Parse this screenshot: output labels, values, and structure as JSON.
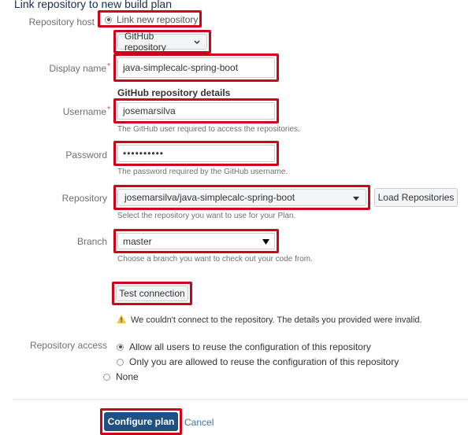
{
  "page": {
    "heading": "Link repository to new build plan"
  },
  "repository_host": {
    "label": "Repository host",
    "option_label": "Link new repository",
    "type_select": "GitHub repository"
  },
  "display_name": {
    "label": "Display name",
    "value": "java-simplecalc-spring-boot"
  },
  "github_details": {
    "heading": "GitHub repository details"
  },
  "username": {
    "label": "Username",
    "value": "josemarsilva",
    "help": "The GitHub user required to access the repositories."
  },
  "password": {
    "label": "Password",
    "value": "••••••••••",
    "help": "The password required by the GitHub username."
  },
  "repository": {
    "label": "Repository",
    "value": "josemarsilva/java-simplecalc-spring-boot",
    "load_button": "Load Repositories",
    "help": "Select the repository you want to use for your Plan."
  },
  "branch": {
    "label": "Branch",
    "value": "master",
    "help": "Choose a branch you want to check out your code from."
  },
  "test_connection": {
    "button": "Test connection",
    "warning": "We couldn't connect to the repository. The details you provided were invalid."
  },
  "repository_access": {
    "label": "Repository access",
    "options": [
      "Allow all users to reuse the configuration of this repository",
      "Only you are allowed to reuse the configuration of this repository",
      "None"
    ]
  },
  "actions": {
    "configure_plan": "Configure plan",
    "cancel": "Cancel"
  },
  "colors": {
    "highlight": "#d0021b",
    "primary": "#205081",
    "link": "#3b73af",
    "warning": "#f6c342"
  },
  "icons": [
    "warning-icon",
    "chevron-down-icon",
    "caret-down-icon",
    "radio-icon"
  ]
}
